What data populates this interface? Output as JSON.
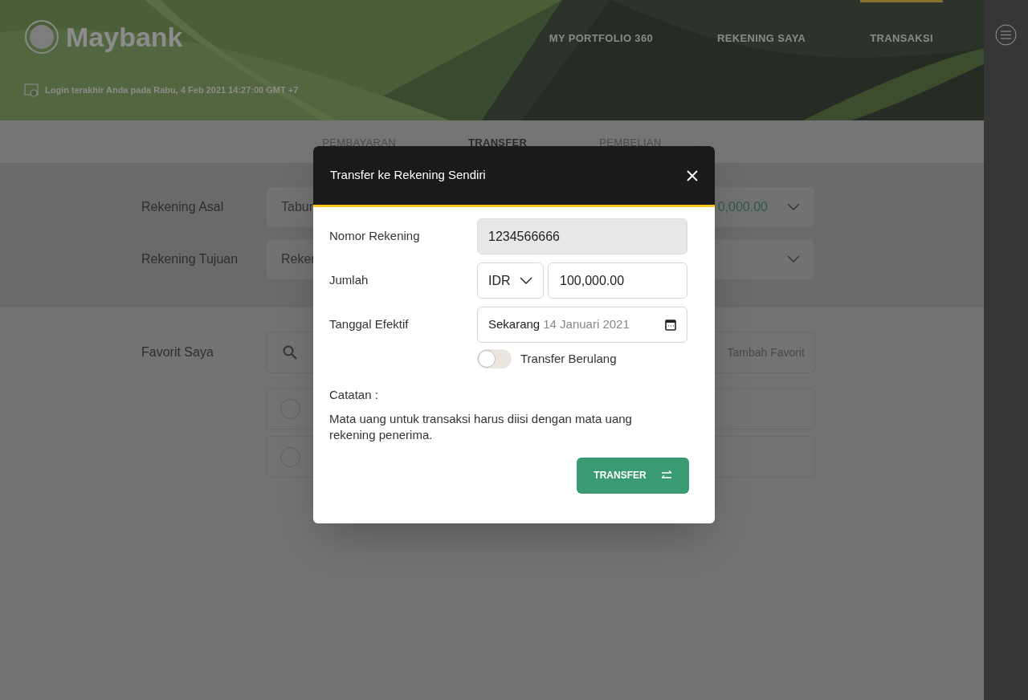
{
  "header": {
    "logo": "Maybank",
    "last_login": "Login terakhir Anda pada Rabu, 4 Feb 2021 14:27:00 GMT +7",
    "nav": [
      {
        "label": "MY PORTFOLIO 360",
        "selected": false
      },
      {
        "label": "REKENING SAYA",
        "selected": false
      },
      {
        "label": "TRANSAKSI",
        "selected": true
      }
    ]
  },
  "tabs": [
    {
      "label": "PEMBAYARAN",
      "selected": false
    },
    {
      "label": "TRANSFER",
      "selected": true
    },
    {
      "label": "PEMBELIAN",
      "selected": false
    }
  ],
  "form": [
    {
      "label": "Rekening Asal",
      "value": "Tabur",
      "amount": "0,000.00"
    },
    {
      "label": "Rekening Tujuan",
      "value": "Reker"
    }
  ],
  "favorites": {
    "label": "Favorit Saya",
    "add_label": "Tambah Favorit",
    "items": [
      {
        "selected": false
      },
      {
        "selected": false
      }
    ]
  },
  "modal": {
    "title": "Transfer ke Rekening Sendiri",
    "account_label": "Nomor Rekening",
    "account_value": "1234566666",
    "amount_label": "Jumlah",
    "currency": "IDR",
    "amount_value": "100,000.00",
    "date_label": "Tanggal Efektif",
    "date_mode": "Sekarang",
    "date_value": "14 Januari 2021",
    "recurring": {
      "label": "Transfer Berulang",
      "on": false
    },
    "note_title": "Catatan :",
    "note": "Mata uang untuk transaksi harus diisi dengan mata uang rekening penerima.",
    "button": "TRANSFER"
  }
}
